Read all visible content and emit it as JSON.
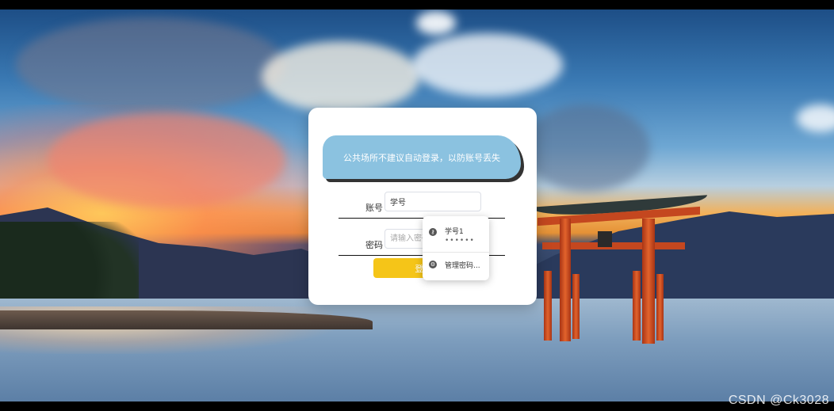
{
  "notice": "公共场所不建议自动登录，以防账号丢失",
  "form": {
    "account_label": "账号",
    "account_value": "学号",
    "password_label": "密码",
    "password_placeholder": "请输入密码",
    "login_button": "登 录"
  },
  "autocomplete": {
    "entry_name": "学号1",
    "entry_secret": "••••••",
    "manage": "管理密码..."
  },
  "watermark": "CSDN @Ck3028",
  "icons": {
    "entry": "key-icon",
    "manage": "settings-icon"
  },
  "colors": {
    "notice_bg": "#8bc2e0",
    "button_bg": "#f5c518"
  }
}
